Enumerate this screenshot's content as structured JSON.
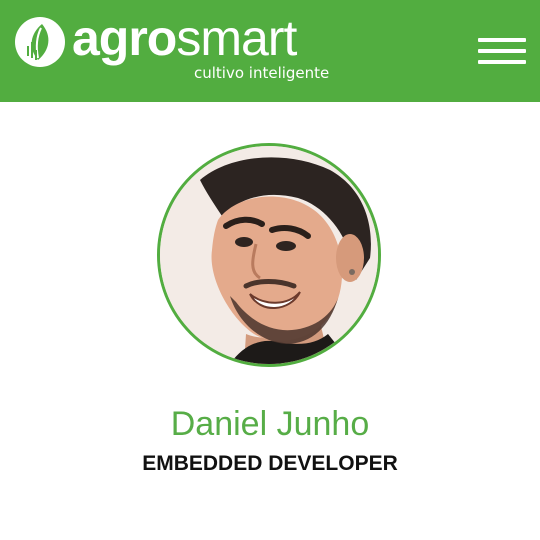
{
  "header": {
    "brand_bold": "agro",
    "brand_light": "smart",
    "tagline": "cultivo inteligente",
    "logo_icon": "leaf-circle-icon",
    "menu_icon": "hamburger-menu-icon",
    "background_color": "#52ad40"
  },
  "profile": {
    "name": "Daniel Junho",
    "role": "EMBEDDED DEVELOPER",
    "avatar": "profile-photo",
    "accent_color": "#57ad47"
  }
}
